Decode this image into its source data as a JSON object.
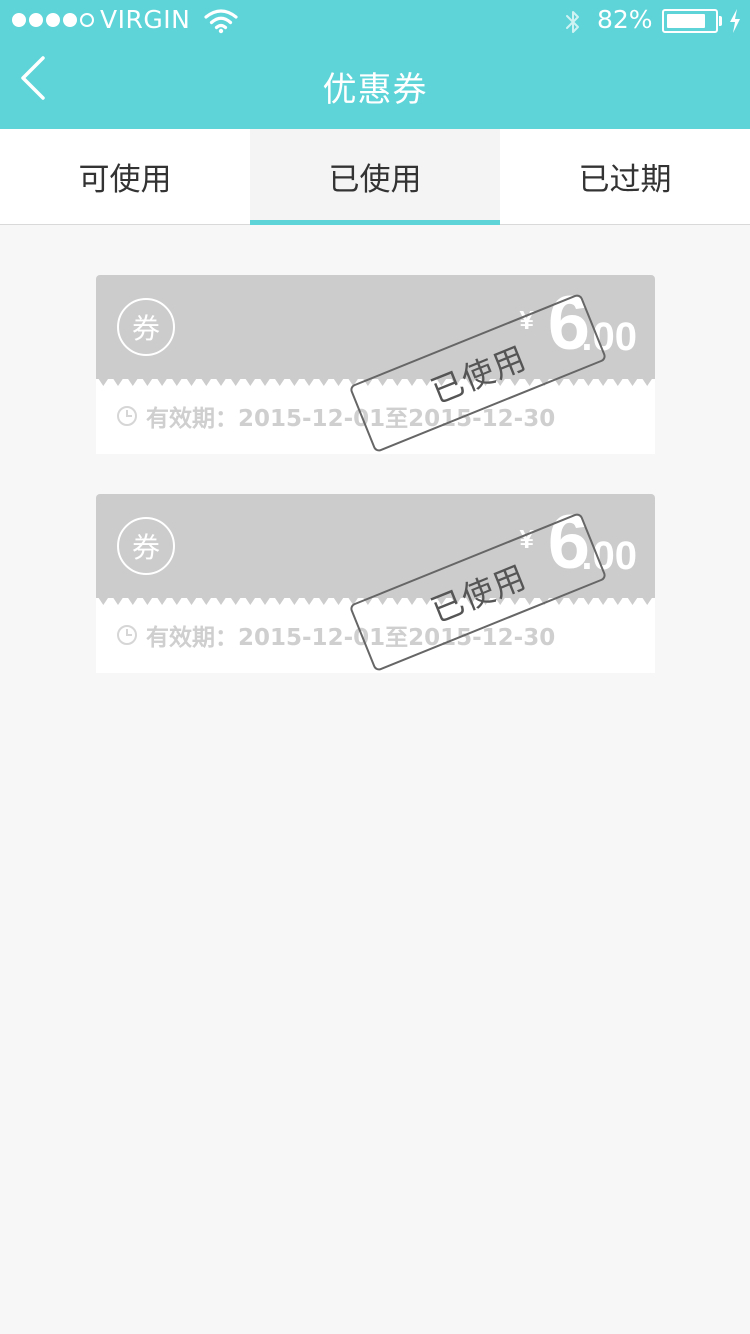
{
  "status_bar": {
    "carrier": "VIRGIN",
    "battery_percent": "82%",
    "battery_level": 0.82,
    "signal_bars": 4,
    "icons": [
      "wifi-icon",
      "bluetooth-icon",
      "battery-icon",
      "charging-icon"
    ]
  },
  "header": {
    "title": "优惠券",
    "back_icon": "chevron-left-icon"
  },
  "tabs": [
    {
      "label": "可使用",
      "active": false
    },
    {
      "label": "已使用",
      "active": true
    },
    {
      "label": "已过期",
      "active": false
    }
  ],
  "coupons": [
    {
      "badge": "券",
      "currency": "¥",
      "amount_int": "6",
      "amount_dec": ".00",
      "validity": "有效期：2015-12-01至2015-12-30",
      "stamp": "已使用"
    },
    {
      "badge": "券",
      "currency": "¥",
      "amount_int": "6",
      "amount_dec": ".00",
      "validity": "有效期：2015-12-01至2015-12-30",
      "stamp": "已使用"
    }
  ],
  "colors": {
    "accent": "#5ed4d8",
    "coupon_used": "#cccccc",
    "background": "#f7f7f7"
  }
}
